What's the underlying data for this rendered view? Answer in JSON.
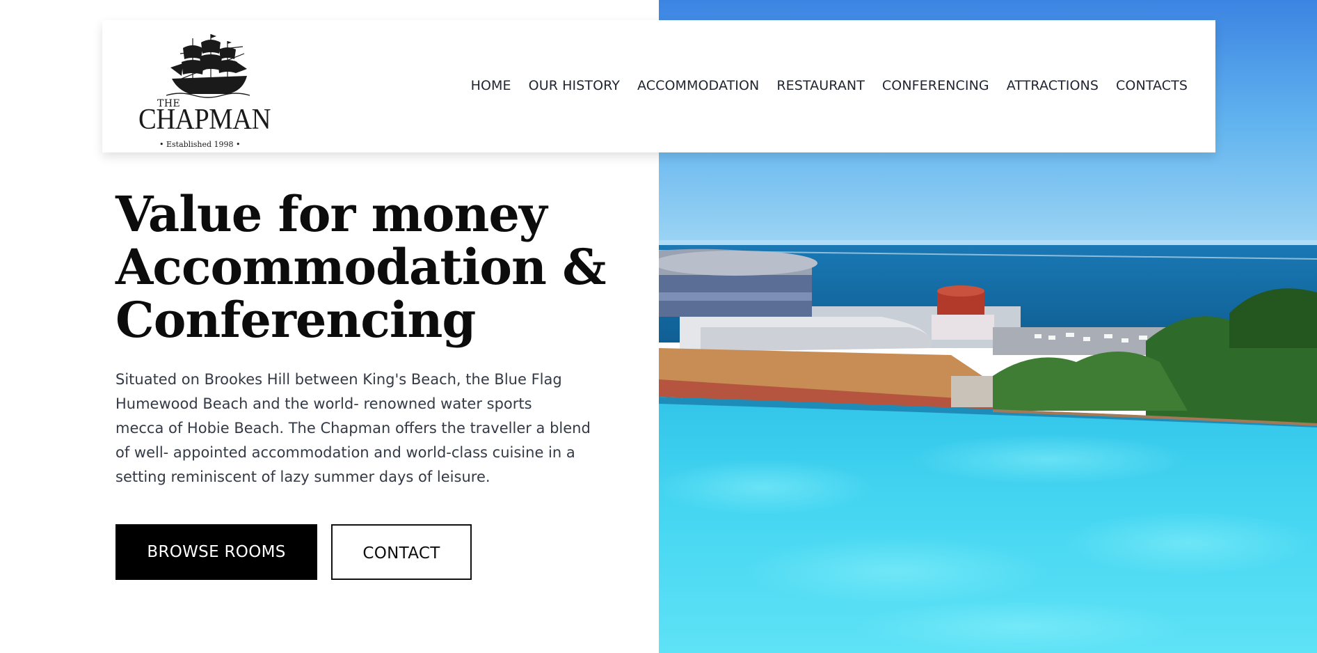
{
  "brand": {
    "logo_the": "THE",
    "logo_name": "CHAPMAN",
    "logo_established": "• Established 1998 •"
  },
  "nav": {
    "items": [
      {
        "label": "HOME"
      },
      {
        "label": "OUR HISTORY"
      },
      {
        "label": "ACCOMMODATION"
      },
      {
        "label": "RESTAURANT"
      },
      {
        "label": "CONFERENCING"
      },
      {
        "label": "ATTRACTIONS"
      },
      {
        "label": "CONTACTS"
      }
    ]
  },
  "hero": {
    "headline_lines": [
      "Value for money",
      "Accommodation &",
      "Conferencing"
    ],
    "description_lines": [
      "Situated on Brookes Hill between King's Beach, the Blue Flag",
      "Humewood Beach and the world- renowned water sports",
      "mecca of Hobie Beach. The Chapman offers the traveller a blend",
      "of well- appointed accommodation and world-class cuisine in a",
      "setting reminiscent of lazy summer days of leisure."
    ],
    "primary_button": "BROWSE ROOMS",
    "secondary_button": "CONTACT",
    "image_icon": "hotel-pool-sea-view-photo"
  },
  "colors": {
    "text_dark": "#0c0c0c",
    "body_text": "#333a46",
    "nav_text": "#1f2430",
    "button_bg": "#000000",
    "pool": "#3fd6ef",
    "sky": "#3f8fe6",
    "sea": "#1b6fa8"
  }
}
